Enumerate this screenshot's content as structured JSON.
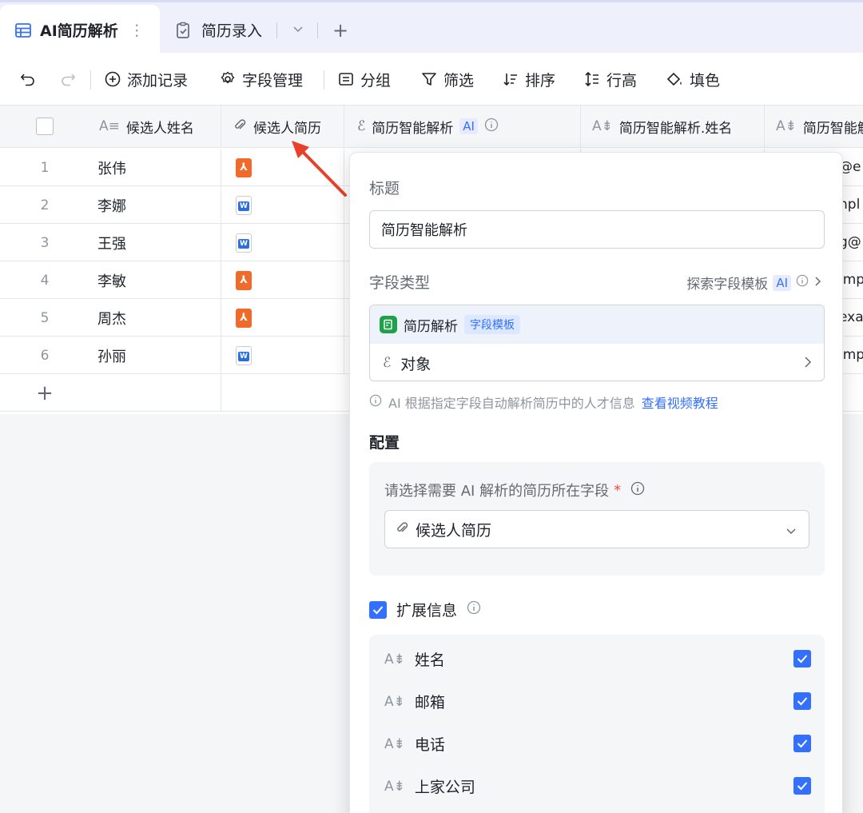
{
  "tabs": {
    "active_label": "AI简历解析",
    "second_label": "简历录入",
    "add": "+"
  },
  "toolbar": {
    "add_record": "添加记录",
    "field_manage": "字段管理",
    "group": "分组",
    "filter": "筛选",
    "sort": "排序",
    "row_height": "行高",
    "fill_color": "填色"
  },
  "columns": {
    "name": "候选人姓名",
    "resume": "候选人简历",
    "ai_parse": "简历智能解析",
    "ai_badge": "AI",
    "parsed_name": "简历智能解析.姓名",
    "parsed_more": "简历智能解"
  },
  "rows": [
    {
      "num": "1",
      "name": "张伟",
      "file": "pdf",
      "email_tail": "@e"
    },
    {
      "num": "2",
      "name": "李娜",
      "file": "doc",
      "email_tail": "npl"
    },
    {
      "num": "3",
      "name": "王强",
      "file": "doc",
      "email_tail": "g@"
    },
    {
      "num": "4",
      "name": "李敏",
      "file": "pdf",
      "email_tail": "ımp"
    },
    {
      "num": "5",
      "name": "周杰",
      "file": "pdf",
      "email_tail": "exa"
    },
    {
      "num": "6",
      "name": "孙丽",
      "file": "doc",
      "email_tail": "ımp"
    }
  ],
  "add_row": "+",
  "panel": {
    "title_label": "标题",
    "title_value": "简历智能解析",
    "field_type_label": "字段类型",
    "explore_templates": "探索字段模板",
    "ai_badge": "AI",
    "option_resume_parse": "简历解析",
    "option_tag": "字段模板",
    "option_object": "对象",
    "hint_text": "AI 根据指定字段自动解析简历中的人才信息",
    "hint_link": "查看视频教程",
    "config_label": "配置",
    "select_prompt": "请选择需要 AI 解析的简历所在字段",
    "required_mark": "*",
    "select_value": "候选人简历",
    "extend_label": "扩展信息",
    "extend_items": [
      "姓名",
      "邮箱",
      "电话",
      "上家公司"
    ]
  },
  "colors": {
    "accent": "#3370ff",
    "pdf": "#f06a2a",
    "arrow": "#e8402a",
    "tab_bg": "#eef0fc"
  }
}
